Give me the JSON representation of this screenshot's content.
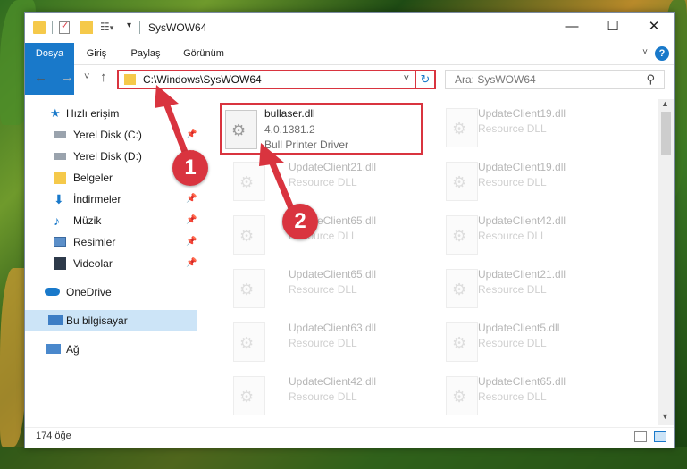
{
  "window": {
    "title": "SysWOW64",
    "minimize": "—",
    "maximize": "☐",
    "close": "✕"
  },
  "ribbon": {
    "tabs": [
      "Dosya",
      "Giriş",
      "Paylaş",
      "Görünüm"
    ],
    "help": "?"
  },
  "nav": {
    "back": "←",
    "forward": "→",
    "recent": "˅",
    "up": "↑",
    "address": "C:\\Windows\\SysWOW64",
    "search_placeholder": "Ara: SysWOW64"
  },
  "sidebar": {
    "items": [
      {
        "label": "Hızlı erişim",
        "pinned": false
      },
      {
        "label": "Yerel Disk (C:)",
        "pinned": true
      },
      {
        "label": "Yerel Disk (D:)",
        "pinned": true
      },
      {
        "label": "Belgeler",
        "pinned": false
      },
      {
        "label": "İndirmeler",
        "pinned": true
      },
      {
        "label": "Müzik",
        "pinned": true
      },
      {
        "label": "Resimler",
        "pinned": true
      },
      {
        "label": "Videolar",
        "pinned": true
      },
      {
        "label": "OneDrive",
        "pinned": false
      },
      {
        "label": "Bu bilgisayar",
        "pinned": false
      },
      {
        "label": "Ağ",
        "pinned": false
      }
    ]
  },
  "files": [
    {
      "name": "bullaser.dll",
      "line1": "4.0.1381.2",
      "line2": "Bull Printer Driver"
    },
    {
      "name": "UpdateClient19.dll",
      "line1": "Resource DLL",
      "line2": ""
    },
    {
      "name": "UpdateClient21.dll",
      "line1": "Resource DLL",
      "line2": ""
    },
    {
      "name": "UpdateClient19.dll",
      "line1": "Resource DLL",
      "line2": ""
    },
    {
      "name": "UpdateClient65.dll",
      "line1": "Resource DLL",
      "line2": ""
    },
    {
      "name": "UpdateClient42.dll",
      "line1": "Resource DLL",
      "line2": ""
    },
    {
      "name": "UpdateClient65.dll",
      "line1": "Resource DLL",
      "line2": ""
    },
    {
      "name": "UpdateClient21.dll",
      "line1": "Resource DLL",
      "line2": ""
    },
    {
      "name": "UpdateClient63.dll",
      "line1": "Resource DLL",
      "line2": ""
    },
    {
      "name": "UpdateClient5.dll",
      "line1": "Resource DLL",
      "line2": ""
    },
    {
      "name": "UpdateClient42.dll",
      "line1": "Resource DLL",
      "line2": ""
    },
    {
      "name": "UpdateClient65.dll",
      "line1": "Resource DLL",
      "line2": ""
    }
  ],
  "status": {
    "count": "174 öğe"
  },
  "annotations": {
    "callout1": "1",
    "callout2": "2",
    "color": "#d9343f"
  }
}
